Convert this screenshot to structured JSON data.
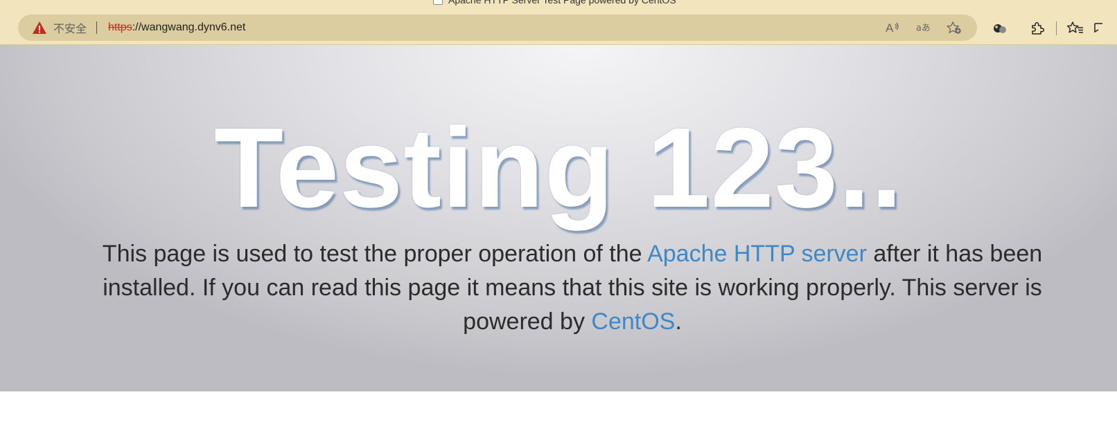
{
  "window": {
    "title": "Apache HTTP Server Test Page powered by CentOS"
  },
  "addressbar": {
    "security_label": "不安全",
    "url_scheme": "https",
    "url_rest": "://wangwang.dynv6.net"
  },
  "icons": {
    "security": "warning-triangle-icon",
    "read_aloud": "read-aloud-icon",
    "translate": "translate-icon",
    "add_favorite": "add-favorite-icon",
    "extension_dots": "copilot-icon",
    "extensions": "puzzle-icon",
    "favorites": "favorites-icon"
  },
  "page": {
    "heading": "Testing 123..",
    "desc_part1": "This page is used to test the proper operation of the ",
    "link_apache": "Apache HTTP server",
    "desc_part2": " after it has been installed. If you can read this page it means that this site is working properly. This server is powered by ",
    "link_centos": "CentOS",
    "desc_part3": "."
  },
  "colors": {
    "chrome_bg": "#f2e4bc",
    "addressbar_bg": "#dccda1",
    "link": "#3f88c5",
    "warning": "#c42b1c"
  }
}
